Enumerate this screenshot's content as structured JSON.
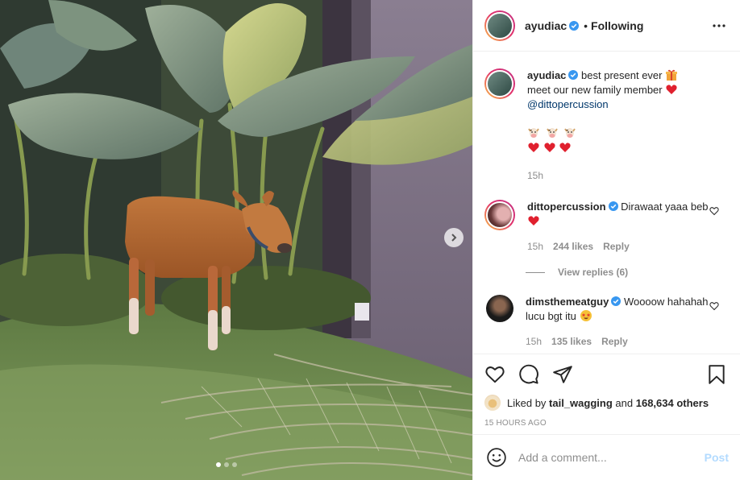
{
  "header": {
    "username": "ayudiac",
    "separator": "•",
    "follow_status": "Following",
    "avatar_icon": "profile-avatar",
    "more_icon": "more-horizontal-icon"
  },
  "caption": {
    "username": "ayudiac",
    "line1": "best present ever",
    "line2": "meet our new family member",
    "mention": "@dittopercussion",
    "emoji_row1": [
      "cow-face-emoji",
      "cow-face-emoji",
      "cow-face-emoji"
    ],
    "emoji_row2": [
      "red-heart-emoji",
      "red-heart-emoji",
      "red-heart-emoji"
    ],
    "time": "15h"
  },
  "comments": [
    {
      "username": "dittopercussion",
      "text": "Dirawaat yaaa beb",
      "time": "15h",
      "likes": "244 likes",
      "reply_label": "Reply",
      "view_replies": "View replies (6)"
    },
    {
      "username": "dimsthemeatguy",
      "text": "Woooow hahahah lucu bgt itu",
      "time": "15h",
      "likes": "135 likes",
      "reply_label": "Reply"
    }
  ],
  "likes": {
    "prefix": "Liked by",
    "user": "tail_wagging",
    "middle": "and",
    "others": "168,634 others"
  },
  "timestamp": "15 HOURS AGO",
  "comment_box": {
    "placeholder": "Add a comment...",
    "post_label": "Post"
  },
  "media": {
    "carousel_slides": 3,
    "active_slide": 1
  },
  "colors": {
    "verified": "#3897f0",
    "heart": "#ed4956",
    "link": "#00376b",
    "muted": "#8e8e8e",
    "post_disabled": "#b3dbff"
  }
}
